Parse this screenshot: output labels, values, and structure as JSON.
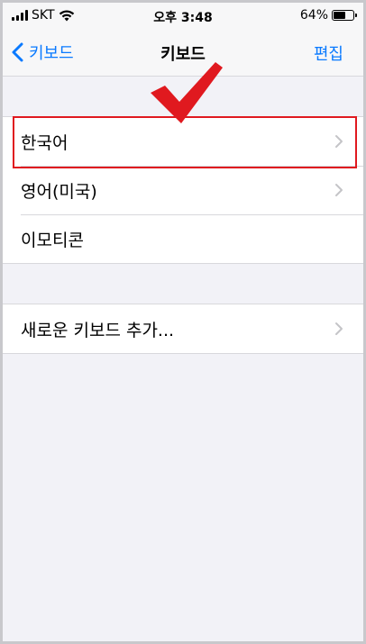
{
  "status_bar": {
    "carrier": "SKT",
    "time": "오후 3:48",
    "battery": "64%",
    "battery_level": 0.64,
    "icons": [
      "signal-icon",
      "wifi-icon",
      "battery-icon"
    ]
  },
  "nav": {
    "back_label": "키보드",
    "title": "키보드",
    "edit_label": "편집",
    "accent": "#0a7aff"
  },
  "keyboards": {
    "items": [
      {
        "label": "한국어",
        "chevron": true
      },
      {
        "label": "영어(미국)",
        "chevron": true
      },
      {
        "label": "이모티콘",
        "chevron": false
      }
    ]
  },
  "add_section": {
    "add_label": "새로운 키보드 추가..."
  },
  "annotations": {
    "highlight_color": "#e0191f",
    "checkmark_color": "#e0191f"
  }
}
